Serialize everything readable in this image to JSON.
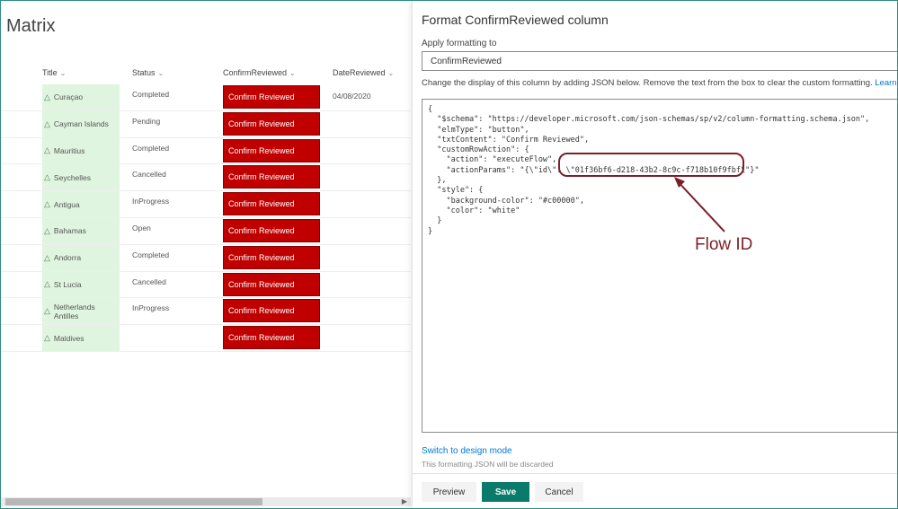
{
  "list": {
    "title": "Matrix",
    "columns": {
      "title": "Title",
      "status": "Status",
      "confirm": "ConfirmReviewed",
      "date": "DateReviewed"
    },
    "rows": [
      {
        "title": "Curaçao",
        "status": "Completed",
        "button": "Confirm Reviewed",
        "date": "04/08/2020"
      },
      {
        "title": "Cayman Islands",
        "status": "Pending",
        "button": "Confirm Reviewed",
        "date": ""
      },
      {
        "title": "Mauritius",
        "status": "Completed",
        "button": "Confirm Reviewed",
        "date": ""
      },
      {
        "title": "Seychelles",
        "status": "Cancelled",
        "button": "Confirm Reviewed",
        "date": ""
      },
      {
        "title": "Antigua",
        "status": "InProgress",
        "button": "Confirm Reviewed",
        "date": ""
      },
      {
        "title": "Bahamas",
        "status": "Open",
        "button": "Confirm Reviewed",
        "date": ""
      },
      {
        "title": "Andorra",
        "status": "Completed",
        "button": "Confirm Reviewed",
        "date": ""
      },
      {
        "title": "St Lucia",
        "status": "Cancelled",
        "button": "Confirm Reviewed",
        "date": ""
      },
      {
        "title": "Netherlands Antilles",
        "status": "InProgress",
        "button": "Confirm Reviewed",
        "date": ""
      },
      {
        "title": "Maldives",
        "status": "",
        "button": "Confirm Reviewed",
        "date": ""
      }
    ],
    "button_color": "#c00000",
    "title_cell_color": "#dff5df"
  },
  "panel": {
    "title": "Format ConfirmReviewed column",
    "apply_label": "Apply formatting to",
    "apply_value": "ConfirmReviewed",
    "description": "Change the display of this column by adding JSON below. Remove the text from the box to clear the custom formatting.",
    "learn_more": "Learn more",
    "json_text": "{\n  \"$schema\": \"https://developer.microsoft.com/json-schemas/sp/v2/column-formatting.schema.json\",\n  \"elmType\": \"button\",\n  \"txtContent\": \"Confirm Reviewed\",\n  \"customRowAction\": {\n    \"action\": \"executeFlow\",\n    \"actionParams\": \"{\\\"id\\\": \\\"01f36bf6-d218-43b2-8c9c-f718b10f9fbf\\\"}\"\n  },\n  \"style\": {\n    \"background-color\": \"#c00000\",\n    \"color\": \"white\"\n  }\n}",
    "annotation": "Flow ID",
    "switch_link": "Switch to design mode",
    "discard_note": "This formatting JSON will be discarded",
    "buttons": {
      "preview": "Preview",
      "save": "Save",
      "cancel": "Cancel"
    },
    "save_color": "#0a7a6b",
    "annotation_color": "#7b1f2a"
  }
}
